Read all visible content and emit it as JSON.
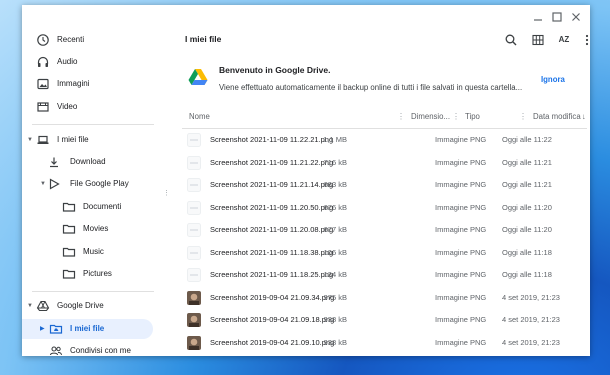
{
  "sidebar": {
    "recents": [
      {
        "label": "Recenti",
        "icon": "clock-icon"
      },
      {
        "label": "Audio",
        "icon": "headphones-icon"
      },
      {
        "label": "Immagini",
        "icon": "image-icon"
      },
      {
        "label": "Video",
        "icon": "video-icon"
      }
    ],
    "my_files": {
      "label": "I miei file",
      "icon": "laptop-icon"
    },
    "download": {
      "label": "Download",
      "icon": "download-icon"
    },
    "play_files": {
      "label": "File Google Play",
      "icon": "play-icon"
    },
    "play_folders": [
      {
        "label": "Documenti"
      },
      {
        "label": "Movies"
      },
      {
        "label": "Music"
      },
      {
        "label": "Pictures"
      }
    ],
    "drive": {
      "label": "Google Drive",
      "icon": "drive-icon"
    },
    "drive_my_files": {
      "label": "I miei file"
    },
    "shared": {
      "label": "Condivisi con me",
      "icon": "people-icon"
    }
  },
  "main": {
    "title": "I miei file",
    "banner": {
      "title": "Benvenuto in Google Drive.",
      "text": "Viene effettuato automaticamente il backup online di tutti i file salvati in questa cartella...",
      "dismiss": "Ignora"
    },
    "columns": {
      "name": "Nome",
      "size": "Dimensio...",
      "type": "Tipo",
      "date": "Data modifica"
    },
    "sort_indicator": "↓",
    "files": [
      {
        "name": "Screenshot 2021-11-09 11.22.21.png",
        "size": "1,1 MB",
        "type": "Immagine PNG",
        "date": "Oggi alle 11:22",
        "thumb": "blank"
      },
      {
        "name": "Screenshot 2021-11-09 11.21.22.png",
        "size": "716 kB",
        "type": "Immagine PNG",
        "date": "Oggi alle 11:21",
        "thumb": "blank"
      },
      {
        "name": "Screenshot 2021-11-09 11.21.14.png",
        "size": "683 kB",
        "type": "Immagine PNG",
        "date": "Oggi alle 11:21",
        "thumb": "blank"
      },
      {
        "name": "Screenshot 2021-11-09 11.20.50.png",
        "size": "676 kB",
        "type": "Immagine PNG",
        "date": "Oggi alle 11:20",
        "thumb": "blank"
      },
      {
        "name": "Screenshot 2021-11-09 11.20.08.png",
        "size": "677 kB",
        "type": "Immagine PNG",
        "date": "Oggi alle 11:20",
        "thumb": "blank"
      },
      {
        "name": "Screenshot 2021-11-09 11.18.38.png",
        "size": "106 kB",
        "type": "Immagine PNG",
        "date": "Oggi alle 11:18",
        "thumb": "blank"
      },
      {
        "name": "Screenshot 2021-11-09 11.18.25.png",
        "size": "134 kB",
        "type": "Immagine PNG",
        "date": "Oggi alle 11:18",
        "thumb": "blank"
      },
      {
        "name": "Screenshot 2019-09-04 21.09.34.png",
        "size": "975 kB",
        "type": "Immagine PNG",
        "date": "4 set 2019, 21:23",
        "thumb": "photo"
      },
      {
        "name": "Screenshot 2019-09-04 21.09.18.png",
        "size": "938 kB",
        "type": "Immagine PNG",
        "date": "4 set 2019, 21:23",
        "thumb": "photo"
      },
      {
        "name": "Screenshot 2019-09-04 21.09.10.png",
        "size": "938 kB",
        "type": "Immagine PNG",
        "date": "4 set 2019, 21:23",
        "thumb": "photo"
      }
    ]
  },
  "toolbar": {
    "sort_label": "AZ"
  },
  "colors": {
    "accent": "#1a73e8",
    "selected_bg": "#e8f0fe"
  }
}
